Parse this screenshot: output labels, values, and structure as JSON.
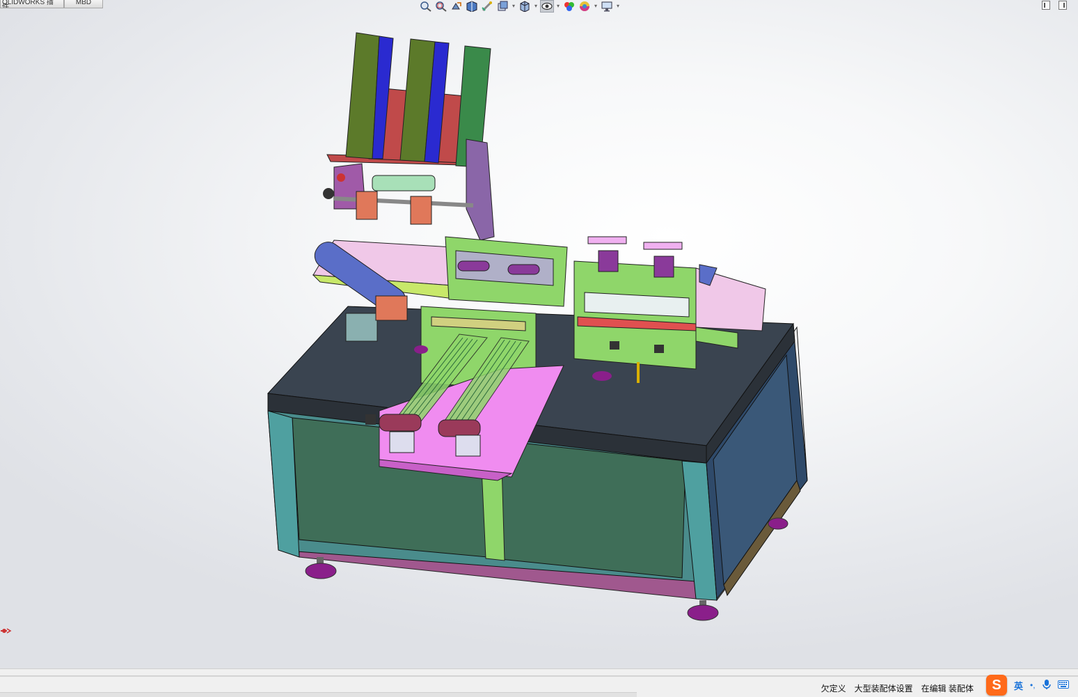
{
  "tabs": [
    {
      "label": "OLIDWORKS 插件"
    },
    {
      "label": "MBD"
    }
  ],
  "heads_up_toolbar": {
    "buttons": [
      {
        "icon": "zoom-to-fit-icon"
      },
      {
        "icon": "zoom-to-area-icon"
      },
      {
        "icon": "previous-view-icon"
      },
      {
        "icon": "section-view-icon"
      },
      {
        "icon": "dynamic-annotation-icon"
      },
      {
        "icon": "view-orientation-icon",
        "dropdown": true
      },
      {
        "icon": "display-style-icon",
        "dropdown": true
      },
      {
        "icon": "hide-show-items-icon",
        "dropdown": true,
        "active": true
      },
      {
        "icon": "edit-appearance-icon"
      },
      {
        "icon": "apply-scene-icon",
        "dropdown": true
      },
      {
        "icon": "view-settings-icon",
        "dropdown": true
      }
    ]
  },
  "statusbar": {
    "items": [
      "欠定义",
      "大型装配体设置",
      "在编辑 装配体"
    ]
  },
  "ime": {
    "logo": "S",
    "lang": "英",
    "punct": "•,",
    "mic_icon": "microphone-icon",
    "keyboard_icon": "keyboard-icon"
  },
  "colors": {
    "table_top": "#3a4450",
    "cabinet_door": "#3f6e58",
    "cabinet_frame": "#4a8c8c",
    "base_rail": "#a0588e",
    "feet": "#8a1f8a",
    "magazine_green": "#5c7a2a",
    "magazine_blue": "#2a2ad0",
    "magazine_red": "#c04a4a",
    "plate_pink": "#f08cf0",
    "frame_lime": "#8fd66a",
    "belt_texture": "#f0c8e8",
    "guard_blue": "#5a6ec8",
    "status_logo": "#ff6a1a"
  }
}
